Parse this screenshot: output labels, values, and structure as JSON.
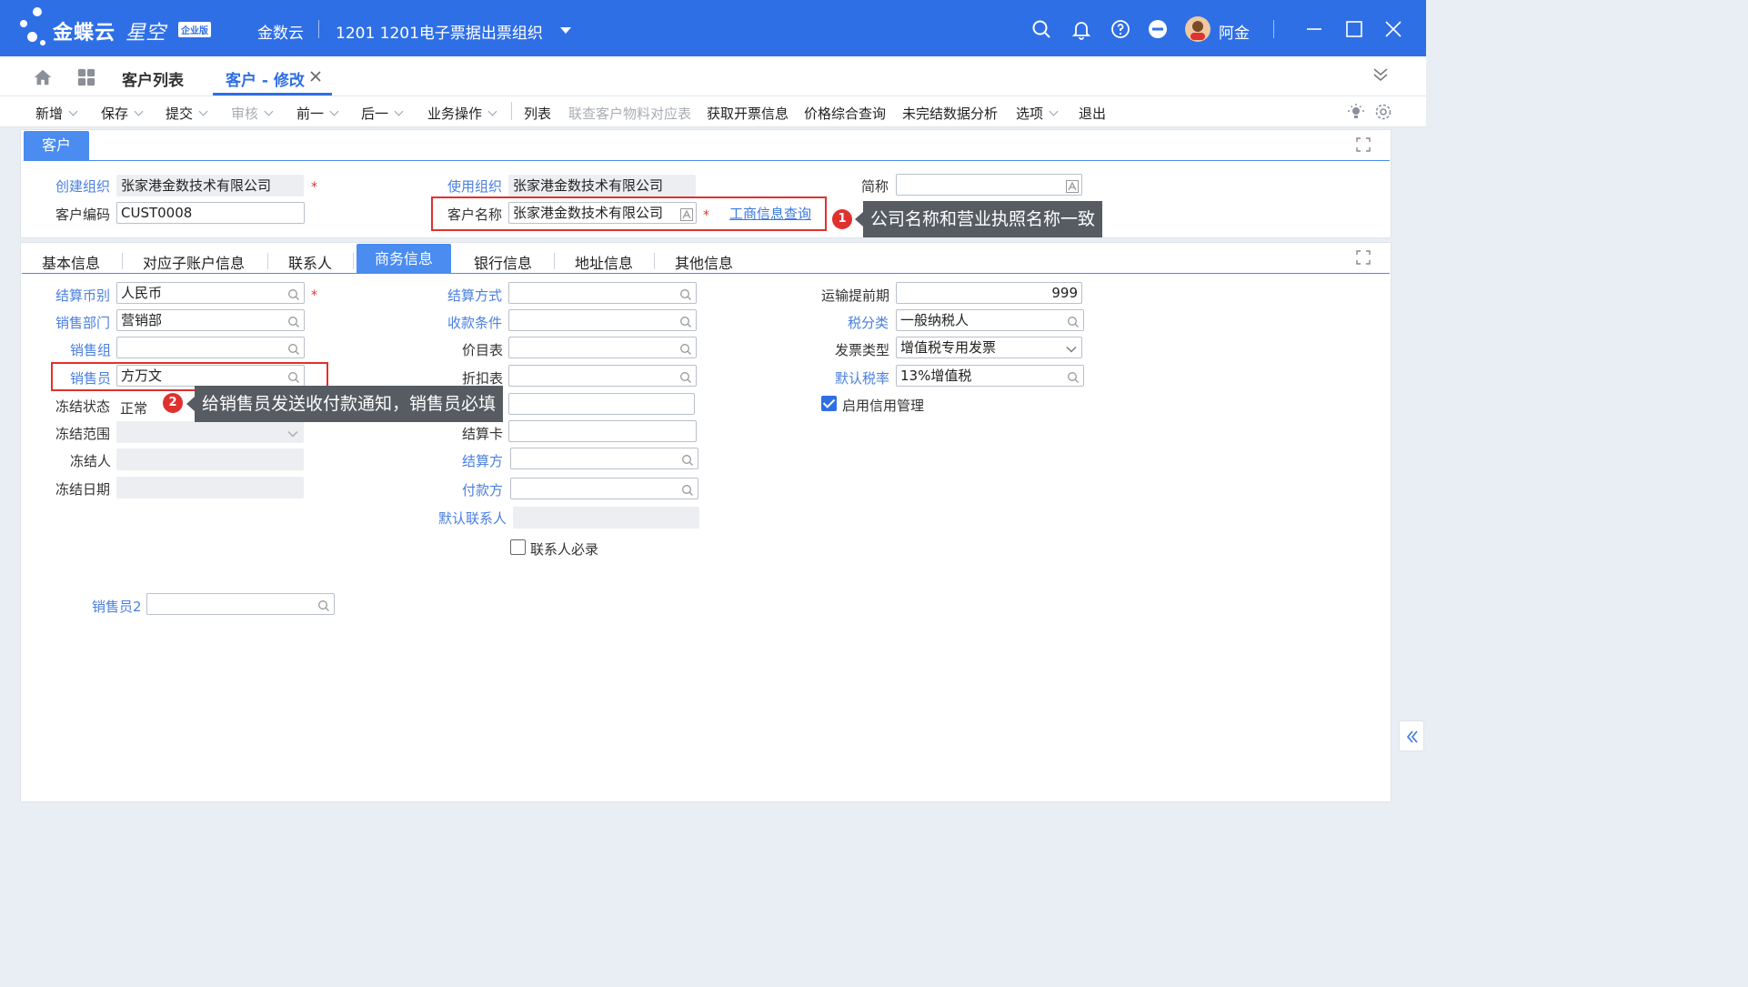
{
  "app": {
    "brand": "金蝶云",
    "product": "星空",
    "edition": "企业版",
    "tenant": "金数云",
    "org": "1201  1201电子票据出票组织",
    "user": "阿金"
  },
  "tabs": {
    "list": "客户列表",
    "active": "客户 - 修改"
  },
  "toolbar": {
    "new": "新增",
    "save": "保存",
    "submit": "提交",
    "audit": "审核",
    "prev": "前一",
    "next": "后一",
    "biz": "业务操作",
    "list": "列表",
    "linked": "联查客户物料对应表",
    "invoice": "获取开票信息",
    "price": "价格综合查询",
    "unfinished": "未完结数据分析",
    "options": "选项",
    "exit": "退出"
  },
  "header": {
    "tab": "客户",
    "create_org_label": "创建组织",
    "create_org": "张家港金数技术有限公司",
    "use_org_label": "使用组织",
    "use_org": "张家港金数技术有限公司",
    "short_label": "简称",
    "short_value": "",
    "code_label": "客户编码",
    "code": "CUST0008",
    "name_label": "客户名称",
    "name": "张家港金数技术有限公司",
    "biz_query": "工商信息查询"
  },
  "annotations": {
    "n1": "1",
    "tip1": "公司名称和营业执照名称一致",
    "n2": "2",
    "tip2": "给销售员发送收付款通知，销售员必填"
  },
  "body_tabs": [
    "基本信息",
    "对应子账户信息",
    "联系人",
    "商务信息",
    "银行信息",
    "地址信息",
    "其他信息"
  ],
  "biz": {
    "currency_label": "结算币别",
    "currency": "人民币",
    "dept_label": "销售部门",
    "dept": "营销部",
    "group_label": "销售组",
    "group": "",
    "sales_label": "销售员",
    "sales": "方万文",
    "freeze_status_label": "冻结状态",
    "freeze_status": "正常",
    "freeze_scope_label": "冻结范围",
    "freezer_label": "冻结人",
    "freeze_date_label": "冻结日期",
    "settle_method_label": "结算方式",
    "payment_terms_label": "收款条件",
    "price_list_label": "价目表",
    "discount_label": "折扣表",
    "settle_card_label": "结算卡",
    "settle_party_label": "结算方",
    "pay_party_label": "付款方",
    "default_contact_label": "默认联系人",
    "contact_required": "联系人必录",
    "lead_time_label": "运输提前期",
    "lead_time": "999",
    "tax_class_label": "税分类",
    "tax_class": "一般纳税人",
    "invoice_type_label": "发票类型",
    "invoice_type": "增值税专用发票",
    "tax_rate_label": "默认税率",
    "tax_rate": "13%增值税",
    "credit_label": "启用信用管理",
    "sales2_label": "销售员2"
  }
}
